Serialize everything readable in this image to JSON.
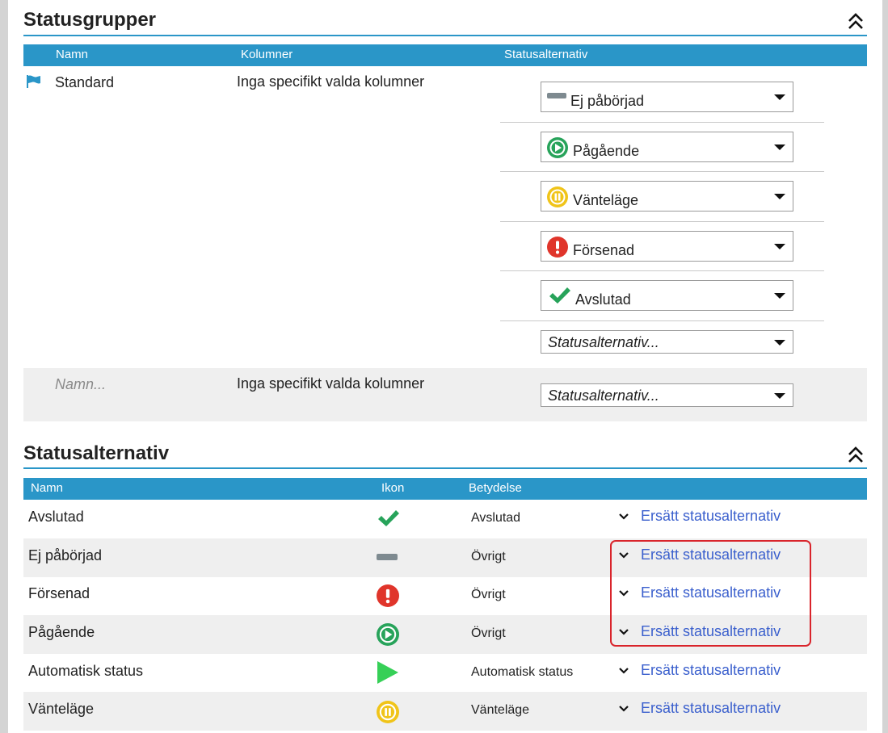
{
  "statusgroups": {
    "title": "Statusgrupper",
    "columns": {
      "name": "Namn",
      "columns": "Kolumner",
      "options": "Statusalternativ"
    },
    "standard": {
      "name": "Standard",
      "columns_text": "Inga specifikt valda kolumner",
      "options": [
        {
          "label": "Ej påbörjad",
          "icon": "dash-icon"
        },
        {
          "label": "Pågående",
          "icon": "play-circle-icon"
        },
        {
          "label": "Vänteläge",
          "icon": "pause-circle-icon"
        },
        {
          "label": "Försenad",
          "icon": "exclamation-circle-icon"
        },
        {
          "label": "Avslutad",
          "icon": "checkmark-icon"
        }
      ],
      "add_option_placeholder": "Statusalternativ..."
    },
    "new_row": {
      "name_placeholder": "Namn...",
      "columns_text": "Inga specifikt valda kolumner",
      "option_placeholder": "Statusalternativ..."
    }
  },
  "statusoptions": {
    "title": "Statusalternativ",
    "columns": {
      "name": "Namn",
      "icon": "Ikon",
      "meaning": "Betydelse"
    },
    "rows": [
      {
        "name": "Avslutad",
        "icon": "checkmark-icon",
        "meaning": "Avslutad",
        "action": "Ersätt statusalternativ"
      },
      {
        "name": "Ej påbörjad",
        "icon": "dash-icon",
        "meaning": "Övrigt",
        "action": "Ersätt statusalternativ"
      },
      {
        "name": "Försenad",
        "icon": "exclamation-circle-icon",
        "meaning": "Övrigt",
        "action": "Ersätt statusalternativ"
      },
      {
        "name": "Pågående",
        "icon": "play-circle-icon",
        "meaning": "Övrigt",
        "action": "Ersätt statusalternativ"
      },
      {
        "name": "Automatisk status",
        "icon": "play-triangle-icon",
        "meaning": "Automatisk status",
        "action": "Ersätt statusalternativ"
      },
      {
        "name": "Vänteläge",
        "icon": "pause-circle-icon",
        "meaning": "Vänteläge",
        "action": "Ersätt statusalternativ"
      }
    ]
  },
  "colors": {
    "header_blue": "#2a96c8",
    "link_blue": "#3a5fcd",
    "green": "#27a35a",
    "red": "#e0352b",
    "yellow": "#f0c419",
    "gray": "#7e8a90",
    "highlight_red": "#d9242b"
  }
}
